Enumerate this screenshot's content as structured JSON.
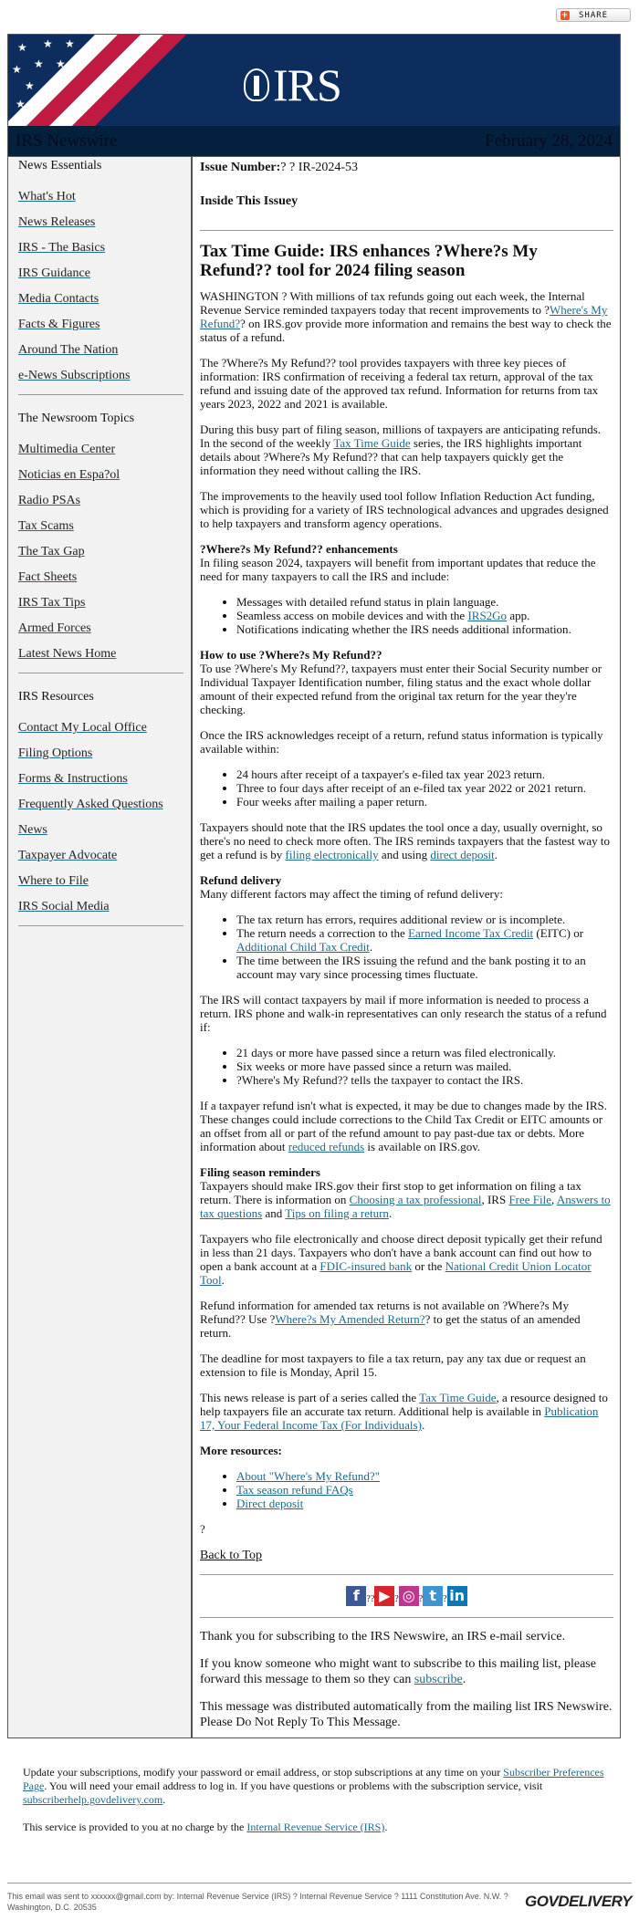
{
  "share": {
    "label": "SHARE",
    "icon": "plus-icon"
  },
  "header": {
    "logo_text": "IRS",
    "newsletter": "IRS Newswire",
    "date": "February 28, 2024"
  },
  "sidebar": {
    "groups": [
      {
        "heading": "News Essentials",
        "items": [
          "What's Hot",
          "News Releases",
          "IRS - The Basics",
          "IRS Guidance",
          "Media Contacts",
          "Facts & Figures",
          "Around The Nation",
          "e-News Subscriptions"
        ]
      },
      {
        "heading": "The Newsroom Topics",
        "items": [
          "Multimedia Center",
          "Noticias en Espa?ol",
          "Radio PSAs",
          "Tax Scams",
          "The Tax Gap",
          "Fact Sheets",
          "IRS Tax Tips",
          "Armed Forces",
          "Latest News Home"
        ]
      },
      {
        "heading": "IRS Resources",
        "items": [
          "Contact My Local Office",
          "Filing Options",
          "Forms & Instructions",
          "Frequently Asked Questions",
          "News",
          "Taxpayer Advocate",
          "Where to File",
          "IRS Social Media"
        ]
      }
    ]
  },
  "main": {
    "issue_label": "Issue Number:",
    "issue_value": "? ? IR-2024-53",
    "inside": "Inside This Issuey",
    "title": "Tax Time Guide: IRS enhances ?Where?s My Refund?? tool for 2024 filing season",
    "blocks": [
      {
        "type": "p",
        "segs": [
          {
            "t": "WASHINGTON ? With millions of tax refunds going out each week, the Internal Revenue Service reminded taxpayers today that recent improvements to ?"
          },
          {
            "t": "Where's My Refund?",
            "link": true
          },
          {
            "t": "? on IRS.gov provide more information and remains the best way to check the status of a refund."
          }
        ]
      },
      {
        "type": "p",
        "segs": [
          {
            "t": "The ?Where?s My Refund?? tool provides taxpayers with three key pieces of information: IRS confirmation of receiving a federal tax return, approval of the tax refund and issuing date of the approved tax refund. Information for returns from tax years 2023, 2022 and 2021 is available."
          }
        ]
      },
      {
        "type": "p",
        "segs": [
          {
            "t": "During this busy part of filing season, millions of taxpayers are anticipating refunds. In the second of the weekly "
          },
          {
            "t": "Tax Time Guide",
            "link": true
          },
          {
            "t": " series, the IRS highlights important details about ?Where?s My Refund?? that can help taxpayers quickly get the information they need without calling the IRS."
          }
        ]
      },
      {
        "type": "p",
        "segs": [
          {
            "t": "The improvements to the heavily used tool follow Inflation Reduction Act funding, which is providing for a variety of IRS technological advances and upgrades designed to help taxpayers and transform agency operations."
          }
        ]
      },
      {
        "type": "h",
        "t": "?Where?s My Refund?? enhancements"
      },
      {
        "type": "p",
        "nomargin": true,
        "segs": [
          {
            "t": "In filing season 2024, taxpayers will benefit from important updates that reduce the need for many taxpayers to call the IRS and include:"
          }
        ]
      },
      {
        "type": "ul",
        "items": [
          [
            {
              "t": "Messages with detailed refund status in plain language."
            }
          ],
          [
            {
              "t": "Seamless access on mobile devices and with the "
            },
            {
              "t": "IRS2Go",
              "link": true
            },
            {
              "t": " app."
            }
          ],
          [
            {
              "t": "Notifications indicating whether the IRS needs additional information."
            }
          ]
        ]
      },
      {
        "type": "h",
        "t": "How to use ?Where?s My Refund??"
      },
      {
        "type": "p",
        "segs": [
          {
            "t": "To use ?Where's My Refund??, taxpayers must enter their Social Security number or Individual Taxpayer Identification number, filing status and the exact whole dollar amount of their expected refund from the original tax return for the year they're checking."
          }
        ]
      },
      {
        "type": "p",
        "nomargin": true,
        "segs": [
          {
            "t": "Once the IRS acknowledges receipt of a return, refund status information is typically available within:"
          }
        ]
      },
      {
        "type": "ul",
        "items": [
          [
            {
              "t": "24 hours after receipt of a taxpayer's e-filed tax year 2023 return."
            }
          ],
          [
            {
              "t": "Three to four days after receipt of an e-filed tax year 2022 or 2021 return."
            }
          ],
          [
            {
              "t": "Four weeks after mailing a paper return."
            }
          ]
        ]
      },
      {
        "type": "p",
        "segs": [
          {
            "t": "Taxpayers should note that the IRS updates the tool once a day, usually overnight, so there's no need to check more often. The IRS reminds taxpayers that the fastest way to get a refund is by "
          },
          {
            "t": "filing electronically",
            "link": true
          },
          {
            "t": " and using "
          },
          {
            "t": "direct deposit",
            "link": true
          },
          {
            "t": "."
          }
        ]
      },
      {
        "type": "h",
        "t": "Refund delivery"
      },
      {
        "type": "p",
        "nomargin": true,
        "segs": [
          {
            "t": "Many different factors may affect the timing of refund delivery:"
          }
        ]
      },
      {
        "type": "ul",
        "items": [
          [
            {
              "t": "The tax return has errors, requires additional review or is incomplete."
            }
          ],
          [
            {
              "t": "The return needs a correction to the "
            },
            {
              "t": "Earned Income Tax Credit",
              "link": true
            },
            {
              "t": " (EITC) or "
            },
            {
              "t": "Additional Child Tax Credit",
              "link": true
            },
            {
              "t": "."
            }
          ],
          [
            {
              "t": "The time between the IRS issuing the refund and the bank posting it to an account may vary since processing times fluctuate."
            }
          ]
        ]
      },
      {
        "type": "p",
        "nomargin": true,
        "segs": [
          {
            "t": "The IRS will contact taxpayers by mail if more information is needed to process a return. IRS phone and walk-in representatives can only research the status of a refund if:"
          }
        ]
      },
      {
        "type": "ul",
        "items": [
          [
            {
              "t": "21 days or more have passed since a return was filed electronically."
            }
          ],
          [
            {
              "t": "Six weeks or more have passed since a return was mailed."
            }
          ],
          [
            {
              "t": "?Where's My Refund?? tells the taxpayer to contact the IRS."
            }
          ]
        ]
      },
      {
        "type": "p",
        "segs": [
          {
            "t": "If a taxpayer refund isn't what is expected, it may be due to changes made by the IRS. These changes could include corrections to the Child Tax Credit or EITC amounts or an offset from all or part of the refund amount to pay past-due tax or debts. More information about "
          },
          {
            "t": "reduced refunds",
            "link": true
          },
          {
            "t": " is available on IRS.gov."
          }
        ]
      },
      {
        "type": "h",
        "t": "Filing season reminders"
      },
      {
        "type": "p",
        "segs": [
          {
            "t": "Taxpayers should make IRS.gov their first stop to get information on filing a tax return. There is information on "
          },
          {
            "t": "Choosing a tax professional",
            "link": true
          },
          {
            "t": ", IRS "
          },
          {
            "t": "Free File",
            "link": true
          },
          {
            "t": ", "
          },
          {
            "t": "Answers to tax questions",
            "link": true
          },
          {
            "t": " and "
          },
          {
            "t": "Tips on filing a return",
            "link": true
          },
          {
            "t": "."
          }
        ]
      },
      {
        "type": "p",
        "segs": [
          {
            "t": "Taxpayers who file electronically and choose direct deposit typically get their refund in less than 21 days. Taxpayers who don't have a bank account can find out how to open a bank account at a "
          },
          {
            "t": "FDIC-insured bank",
            "link": true
          },
          {
            "t": " or the "
          },
          {
            "t": "National Credit Union Locator Tool",
            "link": true
          },
          {
            "t": "."
          }
        ]
      },
      {
        "type": "p",
        "segs": [
          {
            "t": "Refund information for amended tax returns is not available on ?Where?s My Refund?? Use ?"
          },
          {
            "t": "Where?s My Amended Return?",
            "link": true
          },
          {
            "t": "? to get the status of an amended return."
          }
        ]
      },
      {
        "type": "p",
        "segs": [
          {
            "t": "The deadline for most taxpayers to file a tax return, pay any tax due or request an extension to file is Monday, April 15."
          }
        ]
      },
      {
        "type": "p",
        "segs": [
          {
            "t": "This news release is part of a series called the "
          },
          {
            "t": "Tax Time Guide",
            "link": true
          },
          {
            "t": ", a resource designed to help taxpayers file an accurate tax return. Additional help is available in "
          },
          {
            "t": "Publication 17, Your Federal Income Tax (For Individuals)",
            "link": true
          },
          {
            "t": "."
          }
        ]
      },
      {
        "type": "h",
        "t": "More resources:"
      },
      {
        "type": "ul",
        "items": [
          [
            {
              "t": "About \"Where's My Refund?\"",
              "link": true
            }
          ],
          [
            {
              "t": "Tax season refund FAQs",
              "link": true
            }
          ],
          [
            {
              "t": "Direct deposit",
              "link": true
            }
          ]
        ]
      },
      {
        "type": "p",
        "segs": [
          {
            "t": "?"
          }
        ]
      }
    ],
    "back_to_top": "Back to Top",
    "social": [
      {
        "icon": "facebook-icon",
        "glyph": "f",
        "color": "#3b5998",
        "sep": "??"
      },
      {
        "icon": "youtube-icon",
        "glyph": "▶",
        "color": "#d9252a",
        "sep": "?"
      },
      {
        "icon": "instagram-icon",
        "glyph": "◎",
        "color": "#c1358f",
        "sep": "?"
      },
      {
        "icon": "twitter-icon",
        "glyph": "t",
        "color": "#3d95d3",
        "sep": "?"
      },
      {
        "icon": "linkedin-icon",
        "glyph": "in",
        "color": "#0b77b5",
        "sep": ""
      }
    ],
    "thanks": "Thank you for subscribing to the IRS Newswire, an IRS e-mail service.",
    "forward_pre": "If you know someone who might want to subscribe to this mailing list, please forward this message to them so they can ",
    "forward_link": "subscribe",
    "forward_post": ".",
    "auto": "This message was distributed automatically from the mailing list IRS Newswire. Please Do Not Reply To This Message."
  },
  "footer": {
    "update_pre": "Update your subscriptions, modify your password or email address, or stop subscriptions at any time on your ",
    "prefs_link": "Subscriber Preferences Page",
    "update_mid": ". You will need your email address to log in. If you have questions or problems with the subscription service, visit ",
    "help_link": "subscriberhelp.govdelivery.com",
    "update_post": ".",
    "service_pre": "This service is provided to you at no charge by the ",
    "irs_link": "Internal Revenue Service (IRS)",
    "service_post": ".",
    "sent": "This email was sent to xxxxxx@gmail.com by: Internal Revenue Service (IRS) ? Internal Revenue Service ? 1111 Constitution Ave. N.W. ? Washington, D.C. 20535",
    "brand": "GOVDELIVERY"
  }
}
